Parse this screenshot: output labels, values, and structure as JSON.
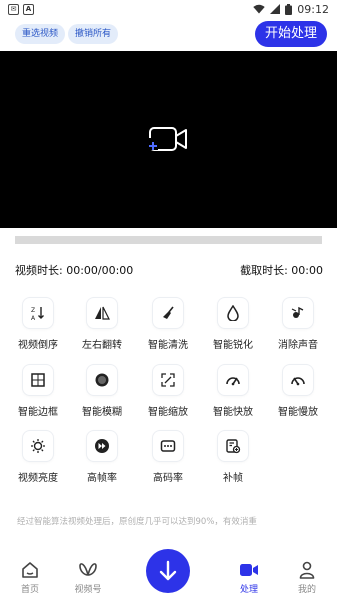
{
  "status_bar": {
    "time": "09:12"
  },
  "toolbar": {
    "reselect_label": "重选视频",
    "undo_all_label": "撤销所有",
    "start_label": "开始处理"
  },
  "durations": {
    "video_duration": "视频时长: 00:00/00:00",
    "clip_duration": "截取时长: 00:00"
  },
  "tools": [
    {
      "label": "视频倒序",
      "icon": "reverse-sort-icon"
    },
    {
      "label": "左右翻转",
      "icon": "flip-icon"
    },
    {
      "label": "智能清洗",
      "icon": "broom-icon"
    },
    {
      "label": "智能锐化",
      "icon": "droplet-icon"
    },
    {
      "label": "消除声音",
      "icon": "mute-icon"
    },
    {
      "label": "智能边框",
      "icon": "border-icon"
    },
    {
      "label": "智能模糊",
      "icon": "blur-icon"
    },
    {
      "label": "智能缩放",
      "icon": "zoom-icon"
    },
    {
      "label": "智能快放",
      "icon": "speed-fast-icon"
    },
    {
      "label": "智能慢放",
      "icon": "speed-slow-icon"
    },
    {
      "label": "视频亮度",
      "icon": "brightness-icon"
    },
    {
      "label": "高帧率",
      "icon": "fast-forward-icon"
    },
    {
      "label": "高码率",
      "icon": "bitrate-icon"
    },
    {
      "label": "补帧",
      "icon": "frame-fill-icon"
    }
  ],
  "note": "经过智能算法视频处理后，原创度几乎可以达到90%，有效消重",
  "tabs": [
    {
      "label": "首页",
      "icon": "home-icon"
    },
    {
      "label": "视频号",
      "icon": "butterfly-icon"
    },
    {
      "label": "处理",
      "icon": "video-camera-icon"
    },
    {
      "label": "我的",
      "icon": "person-icon"
    }
  ],
  "colors": {
    "accent": "#2d33e8",
    "chip_bg": "#e3ecfa"
  }
}
